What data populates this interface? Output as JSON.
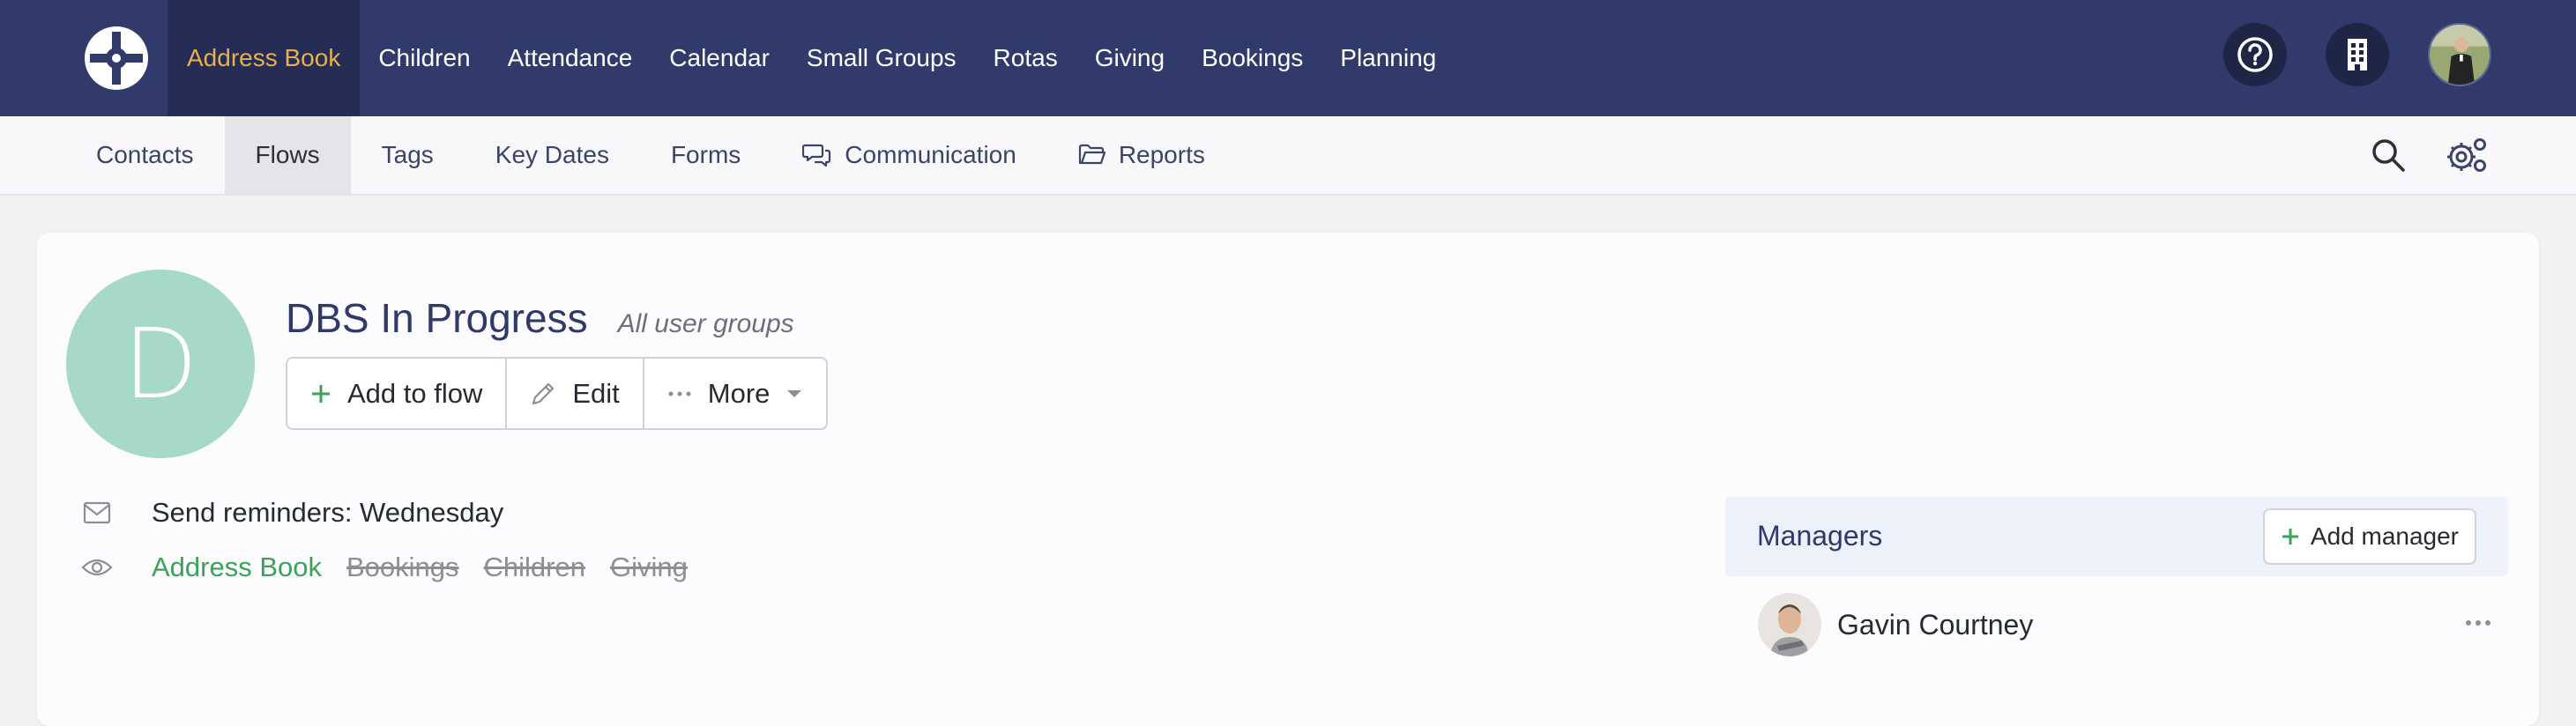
{
  "top_nav": {
    "items": [
      {
        "label": "Address Book"
      },
      {
        "label": "Children"
      },
      {
        "label": "Attendance"
      },
      {
        "label": "Calendar"
      },
      {
        "label": "Small Groups"
      },
      {
        "label": "Rotas"
      },
      {
        "label": "Giving"
      },
      {
        "label": "Bookings"
      },
      {
        "label": "Planning"
      }
    ],
    "active_item": "Address Book"
  },
  "sub_nav": {
    "items": [
      {
        "label": "Contacts"
      },
      {
        "label": "Flows"
      },
      {
        "label": "Tags"
      },
      {
        "label": "Key Dates"
      },
      {
        "label": "Forms"
      },
      {
        "label": "Communication",
        "icon": "chat-icon"
      },
      {
        "label": "Reports",
        "icon": "folder-icon"
      }
    ],
    "active_item": "Flows"
  },
  "flow": {
    "avatar_letter": "D",
    "title": "DBS In Progress",
    "subtitle": "All user groups",
    "actions": {
      "add": "Add to flow",
      "edit": "Edit",
      "more": "More"
    },
    "reminder": "Send reminders: Wednesday",
    "visibility": [
      {
        "label": "Address Book",
        "enabled": true
      },
      {
        "label": "Bookings",
        "enabled": false
      },
      {
        "label": "Children",
        "enabled": false
      },
      {
        "label": "Giving",
        "enabled": false
      }
    ]
  },
  "managers": {
    "heading": "Managers",
    "add_label": "Add manager",
    "list": [
      {
        "name": "Gavin Courtney"
      }
    ]
  },
  "colors": {
    "nav_bg": "#303a6b",
    "nav_active_bg": "#252c55",
    "nav_active_text": "#e7b04f",
    "avatar_bg": "#a7d9c9",
    "accent_green": "#3aa35a"
  }
}
